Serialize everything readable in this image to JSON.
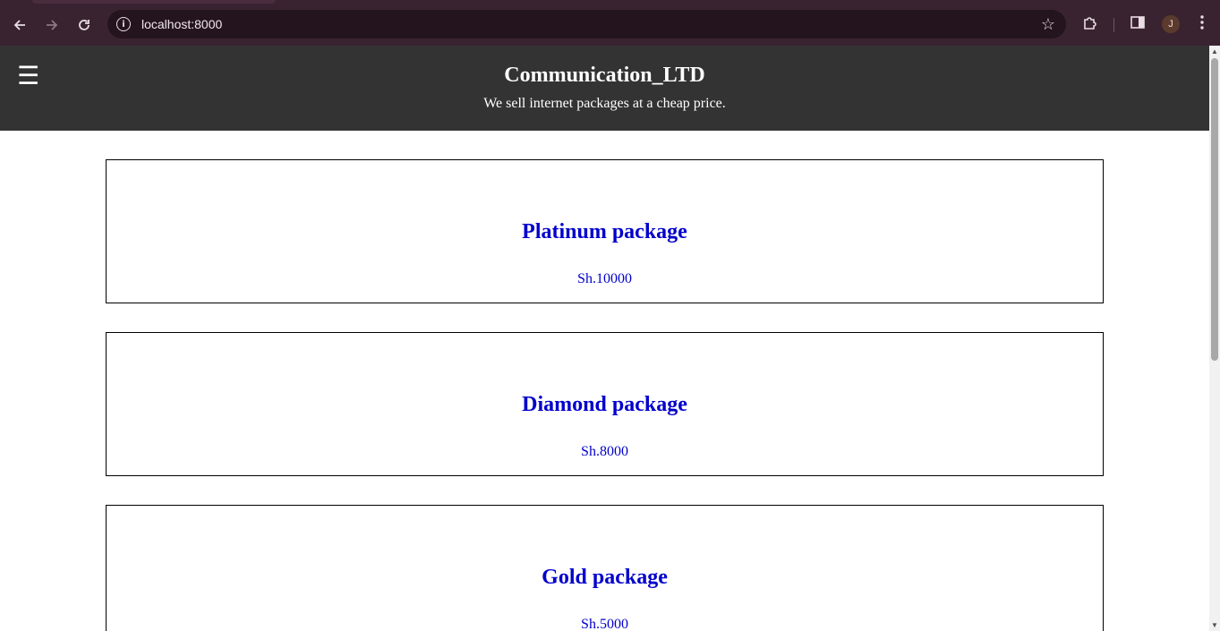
{
  "browser": {
    "url": "localhost:8000",
    "profile_initial": "J",
    "icons": {
      "back": "arrow-left-icon",
      "forward": "arrow-right-icon",
      "reload": "reload-icon",
      "site_info": "info-icon",
      "bookmark": "star-icon",
      "extensions": "puzzle-icon",
      "side_panel": "side-panel-icon",
      "menu": "kebab-menu-icon"
    }
  },
  "header": {
    "menu_icon": "hamburger-icon",
    "title": "Communication_LTD",
    "tagline": "We sell internet packages at a cheap price."
  },
  "packages": [
    {
      "name": "Platinum package",
      "price": "Sh.10000"
    },
    {
      "name": "Diamond package",
      "price": "Sh.8000"
    },
    {
      "name": "Gold package",
      "price": "Sh.5000"
    }
  ],
  "colors": {
    "header_bg": "#333333",
    "package_text": "#0000cc",
    "browser_frame": "#3a2330"
  }
}
